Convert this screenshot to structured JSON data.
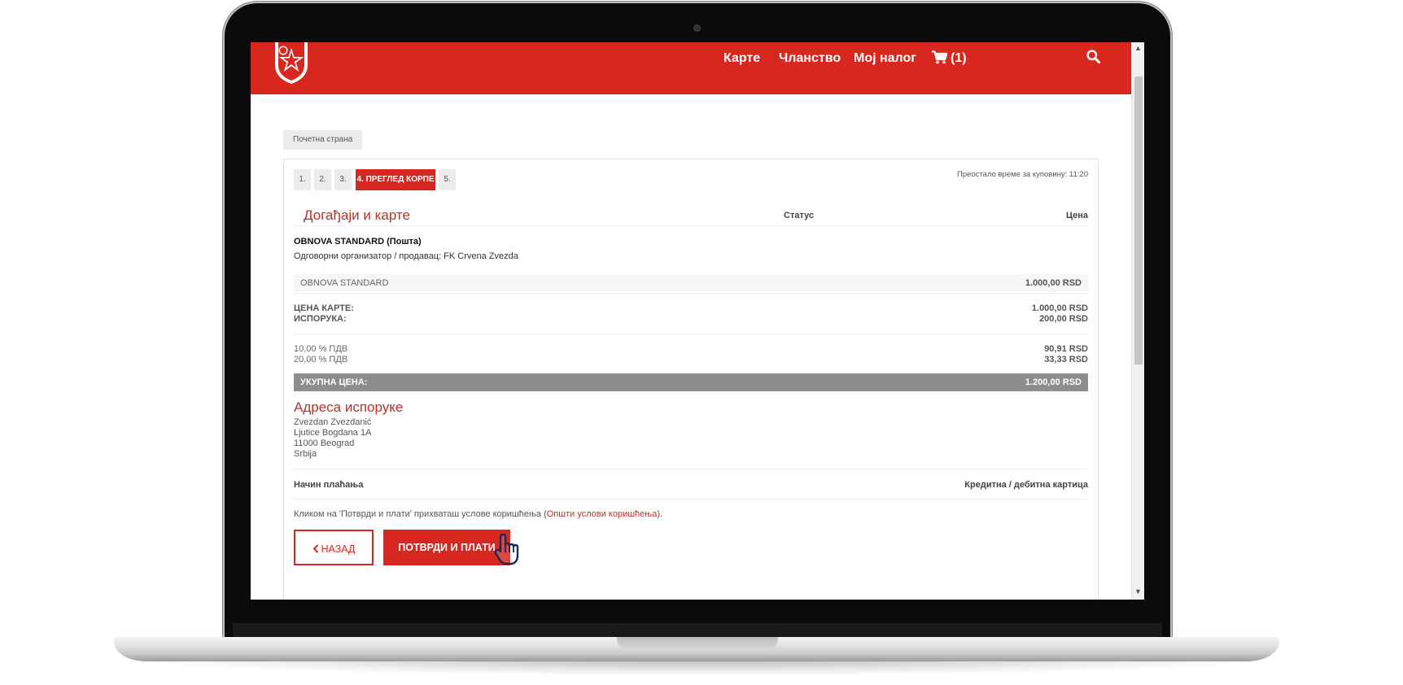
{
  "header": {
    "nav": [
      {
        "label": "Карте"
      },
      {
        "label": "Чланство"
      },
      {
        "label": "Мој налог"
      }
    ],
    "cart_label": "(1)",
    "icons": {
      "logo": "red-star-crest-logo",
      "cart": "cart-icon",
      "search": "search-icon"
    },
    "brand_color": "#d7271e"
  },
  "breadcrumb": {
    "home": "Почетна страна"
  },
  "steps": [
    {
      "label": "1."
    },
    {
      "label": "2."
    },
    {
      "label": "3."
    },
    {
      "label": "4. ПРЕГЛЕД КОРПЕ",
      "active": true
    },
    {
      "label": "5."
    }
  ],
  "timer": "Преостало време за куповину: 11:20",
  "events": {
    "title": "Догађаји и карте",
    "status_header": "Статус",
    "price_header": "Цена",
    "item_title": "OBNOVA STANDARD (Пошта)",
    "organizer": "Одговорни организатор / продавац: FK Crvena Zvezda",
    "line_name": "OBNOVA STANDARD",
    "line_price": "1.000,00 RSD"
  },
  "summary": {
    "ticket_label": "ЦЕНА КАРТЕ:",
    "ticket_value": "1.000,00 RSD",
    "delivery_label": "ИСПОРУКА:",
    "delivery_value": "200,00 RSD",
    "vat10_label": "10,00 % ПДВ",
    "vat10_value": "90,91 RSD",
    "vat20_label": "20,00 % ПДВ",
    "vat20_value": "33,33 RSD",
    "total_label": "УКУПНА ЦЕНА:",
    "total_value": "1.200,00 RSD"
  },
  "address": {
    "title": "Адреса испоруке",
    "name": "Zvezdan Zvezdanić",
    "street": "Ljutice Bogdana 1A",
    "city": "11000 Beograd",
    "country": "Srbija"
  },
  "payment": {
    "label": "Начин плаћања",
    "value": "Кредитна / дебитна картица"
  },
  "terms": {
    "text": "Кликом на 'Потврди и плати' прихваташ услове коришћења (",
    "link": "Општи услови коришћења",
    "suffix": ")."
  },
  "buttons": {
    "back": "НАЗАД",
    "confirm": "ПОТВРДИ И ПЛАТИ"
  }
}
